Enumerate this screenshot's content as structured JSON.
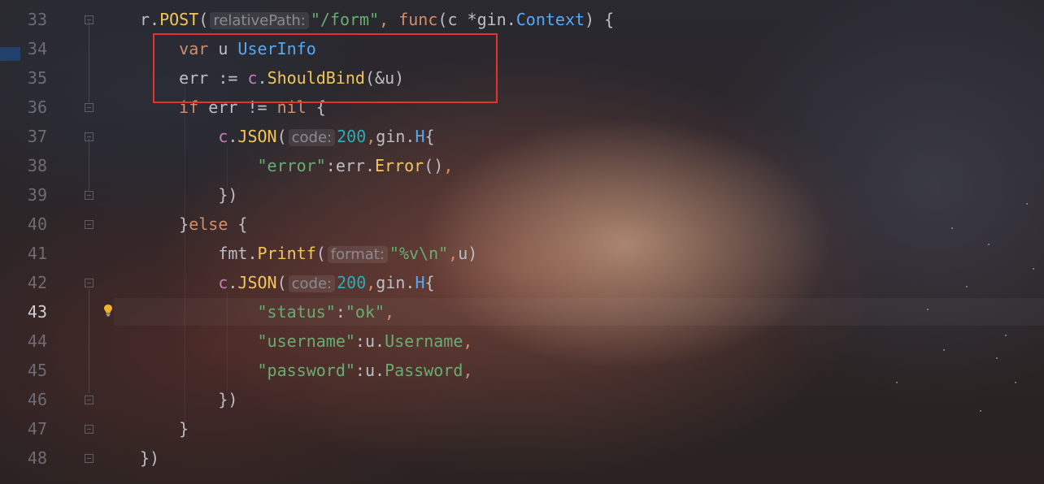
{
  "editor": {
    "line_numbers": [
      "33",
      "34",
      "35",
      "36",
      "37",
      "38",
      "39",
      "40",
      "41",
      "42",
      "43",
      "44",
      "45",
      "46",
      "47",
      "48"
    ],
    "current_line": "43",
    "lines": [
      {
        "n": "33",
        "tokens": [
          {
            "t": "r",
            "c": "var"
          },
          {
            "t": ".",
            "c": "var"
          },
          {
            "t": "POST",
            "c": "fn"
          },
          {
            "t": "(",
            "c": "var"
          },
          {
            "t": "relativePath:",
            "c": "hint"
          },
          {
            "t": "\"/form\"",
            "c": "str"
          },
          {
            "t": ", ",
            "c": "kw"
          },
          {
            "t": "func",
            "c": "kw"
          },
          {
            "t": "(",
            "c": "var"
          },
          {
            "t": "c",
            "c": "var"
          },
          {
            "t": " *",
            "c": "var"
          },
          {
            "t": "gin",
            "c": "pkg"
          },
          {
            "t": ".",
            "c": "var"
          },
          {
            "t": "Context",
            "c": "type"
          },
          {
            "t": ") {",
            "c": "var"
          }
        ]
      },
      {
        "n": "34",
        "tokens": [
          {
            "t": "    ",
            "c": "var"
          },
          {
            "t": "var",
            "c": "kw"
          },
          {
            "t": " u ",
            "c": "var"
          },
          {
            "t": "UserInfo",
            "c": "type"
          }
        ]
      },
      {
        "n": "35",
        "tokens": [
          {
            "t": "    ",
            "c": "var"
          },
          {
            "t": "err",
            "c": "var"
          },
          {
            "t": " := ",
            "c": "var"
          },
          {
            "t": "c",
            "c": "rcv"
          },
          {
            "t": ".",
            "c": "var"
          },
          {
            "t": "ShouldBind",
            "c": "fn"
          },
          {
            "t": "(&u)",
            "c": "var"
          }
        ]
      },
      {
        "n": "36",
        "tokens": [
          {
            "t": "    ",
            "c": "var"
          },
          {
            "t": "if",
            "c": "kw"
          },
          {
            "t": " err != ",
            "c": "var"
          },
          {
            "t": "nil",
            "c": "kw"
          },
          {
            "t": " {",
            "c": "var"
          }
        ]
      },
      {
        "n": "37",
        "tokens": [
          {
            "t": "        ",
            "c": "var"
          },
          {
            "t": "c",
            "c": "rcv"
          },
          {
            "t": ".",
            "c": "var"
          },
          {
            "t": "JSON",
            "c": "fn"
          },
          {
            "t": "(",
            "c": "var"
          },
          {
            "t": "code:",
            "c": "hint"
          },
          {
            "t": "200",
            "c": "num"
          },
          {
            "t": ",",
            "c": "kw"
          },
          {
            "t": "gin",
            "c": "pkg"
          },
          {
            "t": ".",
            "c": "var"
          },
          {
            "t": "H",
            "c": "type"
          },
          {
            "t": "{",
            "c": "var"
          }
        ]
      },
      {
        "n": "38",
        "tokens": [
          {
            "t": "            ",
            "c": "var"
          },
          {
            "t": "\"error\"",
            "c": "str"
          },
          {
            "t": ":",
            "c": "var"
          },
          {
            "t": "err",
            "c": "var"
          },
          {
            "t": ".",
            "c": "var"
          },
          {
            "t": "Error",
            "c": "fn"
          },
          {
            "t": "()",
            "c": "var"
          },
          {
            "t": ",",
            "c": "kw"
          }
        ]
      },
      {
        "n": "39",
        "tokens": [
          {
            "t": "        ",
            "c": "var"
          },
          {
            "t": "})",
            "c": "var"
          }
        ]
      },
      {
        "n": "40",
        "tokens": [
          {
            "t": "    ",
            "c": "var"
          },
          {
            "t": "}",
            "c": "var"
          },
          {
            "t": "else",
            "c": "kw"
          },
          {
            "t": " {",
            "c": "var"
          }
        ]
      },
      {
        "n": "41",
        "tokens": [
          {
            "t": "        ",
            "c": "var"
          },
          {
            "t": "fmt",
            "c": "pkg"
          },
          {
            "t": ".",
            "c": "var"
          },
          {
            "t": "Printf",
            "c": "fn"
          },
          {
            "t": "(",
            "c": "var"
          },
          {
            "t": "format:",
            "c": "hint"
          },
          {
            "t": "\"%v\\n\"",
            "c": "str"
          },
          {
            "t": ",",
            "c": "kw"
          },
          {
            "t": "u)",
            "c": "var"
          }
        ]
      },
      {
        "n": "42",
        "tokens": [
          {
            "t": "        ",
            "c": "var"
          },
          {
            "t": "c",
            "c": "rcv"
          },
          {
            "t": ".",
            "c": "var"
          },
          {
            "t": "JSON",
            "c": "fn"
          },
          {
            "t": "(",
            "c": "var"
          },
          {
            "t": "code:",
            "c": "hint"
          },
          {
            "t": "200",
            "c": "num"
          },
          {
            "t": ",",
            "c": "kw"
          },
          {
            "t": "gin",
            "c": "pkg"
          },
          {
            "t": ".",
            "c": "var"
          },
          {
            "t": "H",
            "c": "type"
          },
          {
            "t": "{",
            "c": "var"
          }
        ]
      },
      {
        "n": "43",
        "tokens": [
          {
            "t": "            ",
            "c": "var"
          },
          {
            "t": "\"status\"",
            "c": "str"
          },
          {
            "t": ":",
            "c": "var"
          },
          {
            "t": "\"ok\"",
            "c": "str"
          },
          {
            "t": ",",
            "c": "kw"
          }
        ]
      },
      {
        "n": "44",
        "tokens": [
          {
            "t": "            ",
            "c": "var"
          },
          {
            "t": "\"username\"",
            "c": "str"
          },
          {
            "t": ":",
            "c": "var"
          },
          {
            "t": "u",
            "c": "var"
          },
          {
            "t": ".",
            "c": "var"
          },
          {
            "t": "Username",
            "c": "str"
          },
          {
            "t": ",",
            "c": "kw"
          }
        ]
      },
      {
        "n": "45",
        "tokens": [
          {
            "t": "            ",
            "c": "var"
          },
          {
            "t": "\"password\"",
            "c": "str"
          },
          {
            "t": ":",
            "c": "var"
          },
          {
            "t": "u",
            "c": "var"
          },
          {
            "t": ".",
            "c": "var"
          },
          {
            "t": "Password",
            "c": "str"
          },
          {
            "t": ",",
            "c": "kw"
          }
        ]
      },
      {
        "n": "46",
        "tokens": [
          {
            "t": "        ",
            "c": "var"
          },
          {
            "t": "})",
            "c": "var"
          }
        ]
      },
      {
        "n": "47",
        "tokens": [
          {
            "t": "    ",
            "c": "var"
          },
          {
            "t": "}",
            "c": "var"
          }
        ]
      },
      {
        "n": "48",
        "tokens": [
          {
            "t": "})",
            "c": "var"
          }
        ]
      }
    ]
  },
  "icons": {
    "fold_marker": "fold-marker-icon",
    "intention": "lightbulb-icon"
  },
  "colors": {
    "highlight_box": "#e5322d",
    "keyword": "#cf8e6d",
    "string": "#6aab73",
    "function": "#f2c55c",
    "number": "#2aacb8",
    "type": "#56a8f5"
  }
}
